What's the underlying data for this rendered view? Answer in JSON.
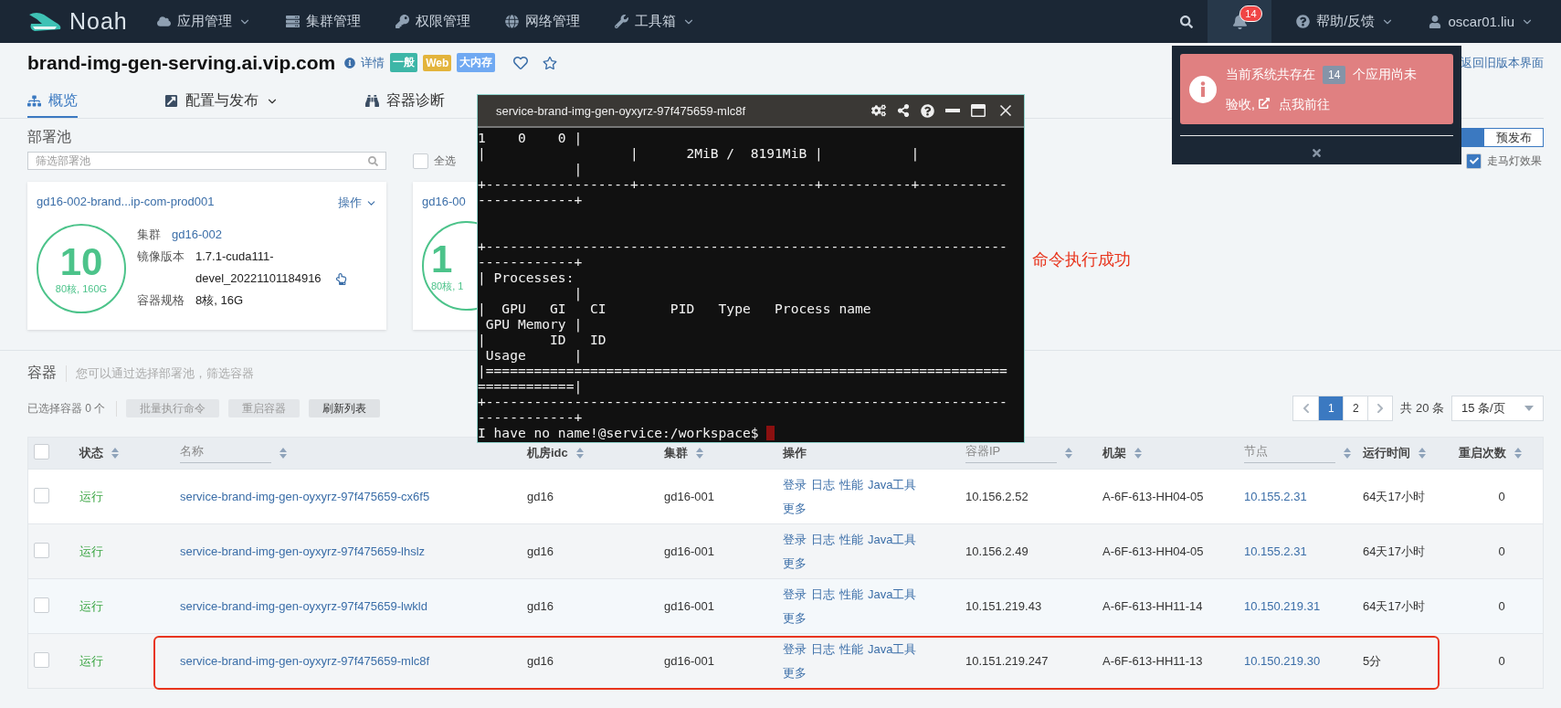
{
  "nav": {
    "logo": "Noah",
    "items": [
      {
        "label": "应用管理",
        "dropdown": true
      },
      {
        "label": "集群管理",
        "dropdown": false
      },
      {
        "label": "权限管理",
        "dropdown": false
      },
      {
        "label": "网络管理",
        "dropdown": false
      },
      {
        "label": "工具箱",
        "dropdown": true
      }
    ],
    "notifications": {
      "badge": "14",
      "active": true
    },
    "help": {
      "label": "帮助/反馈"
    },
    "user": {
      "label": "oscar01.liu"
    }
  },
  "app": {
    "title": "brand-img-gen-serving.ai.vip.com",
    "details_link": "详情",
    "tags": [
      {
        "label": "一般",
        "color": "#3db6a7"
      },
      {
        "label": "Web",
        "color": "#e3b43c"
      },
      {
        "label": "大内存",
        "color": "#70a9f2"
      }
    ],
    "legacy_link": "返回旧版本界面"
  },
  "tabs": [
    {
      "label": "概览",
      "selected": true,
      "dropdown": false
    },
    {
      "label": "配置与发布",
      "selected": false,
      "dropdown": true
    },
    {
      "label": "容器诊断",
      "selected": false,
      "dropdown": false
    }
  ],
  "pools": {
    "heading": "部署池",
    "filter_placeholder": "筛选部署池",
    "select_all": {
      "label": "全选",
      "checked": false
    },
    "segments": [
      {
        "selected": true
      },
      {
        "label": "预发布",
        "selected": false
      }
    ],
    "marquee": {
      "label": "走马灯效果",
      "checked": true
    },
    "cards": [
      {
        "title": "gd16-002-brand...ip-com-prod001",
        "action": "操作",
        "count": "10",
        "capacity": "80核, 160G",
        "fields": [
          {
            "label": "集群",
            "value": "gd16-002",
            "kind": "link"
          },
          {
            "label": "镜像版本",
            "value": "1.7.1-cuda111-devel_20221101184916",
            "kind": "image"
          },
          {
            "label": "容器规格",
            "value": "8核, 16G",
            "kind": "text"
          }
        ]
      },
      {
        "title": "gd16-00",
        "count": "1",
        "capacity": "80核, 1"
      }
    ],
    "toast": "命令执行成功"
  },
  "containers": {
    "heading": "容器",
    "hint": "您可以通过选择部署池，筛选容器",
    "selected_count": "已选择容器 0 个",
    "actions": [
      {
        "label": "批量执行命令",
        "disabled": true
      },
      {
        "label": "重启容器",
        "disabled": true
      },
      {
        "label": "刷新列表",
        "disabled": false
      }
    ],
    "pagination": {
      "pages": [
        {
          "label": "1",
          "selected": true
        },
        {
          "label": "2",
          "selected": false
        }
      ],
      "total": "共 20 条",
      "page_size": "15 条/页"
    },
    "table": {
      "select_all_checked": false,
      "columns": [
        {
          "label": "状态",
          "kind": "sort"
        },
        {
          "label": "名称",
          "kind": "filter"
        },
        {
          "label": "机房idc",
          "kind": "sort"
        },
        {
          "label": "集群",
          "kind": "sort"
        },
        {
          "label": "操作",
          "kind": "plain"
        },
        {
          "label": "容器IP",
          "kind": "filter"
        },
        {
          "label": "机架",
          "kind": "sort"
        },
        {
          "label": "节点",
          "kind": "filter"
        },
        {
          "label": "运行时间",
          "kind": "sort"
        },
        {
          "label": "重启次数",
          "kind": "sort"
        }
      ],
      "rows": [
        {
          "checked": false,
          "highlighted": false,
          "status": "运行",
          "name": "service-brand-img-gen-oyxyrz-97f475659-cx6f5",
          "idc": "gd16",
          "cluster": "gd16-001",
          "ops": [
            "登录",
            "日志",
            "性能",
            "Java工具",
            "更多"
          ],
          "ip": "10.156.2.52",
          "rack": "A-6F-613-HH04-05",
          "node": "10.155.2.31",
          "uptime": "64天17小时",
          "restarts": "0"
        },
        {
          "checked": false,
          "highlighted": false,
          "status": "运行",
          "name": "service-brand-img-gen-oyxyrz-97f475659-lhslz",
          "idc": "gd16",
          "cluster": "gd16-001",
          "ops": [
            "登录",
            "日志",
            "性能",
            "Java工具",
            "更多"
          ],
          "ip": "10.156.2.49",
          "rack": "A-6F-613-HH04-05",
          "node": "10.155.2.31",
          "uptime": "64天17小时",
          "restarts": "0"
        },
        {
          "checked": false,
          "highlighted": false,
          "status": "运行",
          "name": "service-brand-img-gen-oyxyrz-97f475659-lwkld",
          "idc": "gd16",
          "cluster": "gd16-001",
          "ops": [
            "登录",
            "日志",
            "性能",
            "Java工具",
            "更多"
          ],
          "ip": "10.151.219.43",
          "rack": "A-6F-613-HH11-14",
          "node": "10.150.219.31",
          "uptime": "64天17小时",
          "restarts": "0"
        },
        {
          "checked": false,
          "highlighted": true,
          "status": "运行",
          "name": "service-brand-img-gen-oyxyrz-97f475659-mlc8f",
          "idc": "gd16",
          "cluster": "gd16-001",
          "ops": [
            "登录",
            "日志",
            "性能",
            "Java工具",
            "更多"
          ],
          "ip": "10.151.219.247",
          "rack": "A-6F-613-HH11-13",
          "node": "10.150.219.30",
          "uptime": "5分",
          "restarts": "0"
        }
      ]
    }
  },
  "terminal": {
    "title": "service-brand-img-gen-oyxyrz-97f475659-mlc8f",
    "output": "1    0    0 |\n|                  |      2MiB /  8191MiB |           |\n            |\n+------------------+----------------------+-----------+-----------\n------------+\n \n \n+-----------------------------------------------------------------\n------------+\n| Processes:\n            |\n|  GPU   GI   CI        PID   Type   Process name\n GPU Memory |\n|        ID   ID\n Usage      |\n|=================================================================\n============|\n+-----------------------------------------------------------------\n------------+",
    "prompt": "I have no name!@service:/workspace$"
  },
  "notice": {
    "text_before": "当前系统共存在",
    "count": "14",
    "text_after": "个应用尚未验收,",
    "link": "点我前往"
  }
}
